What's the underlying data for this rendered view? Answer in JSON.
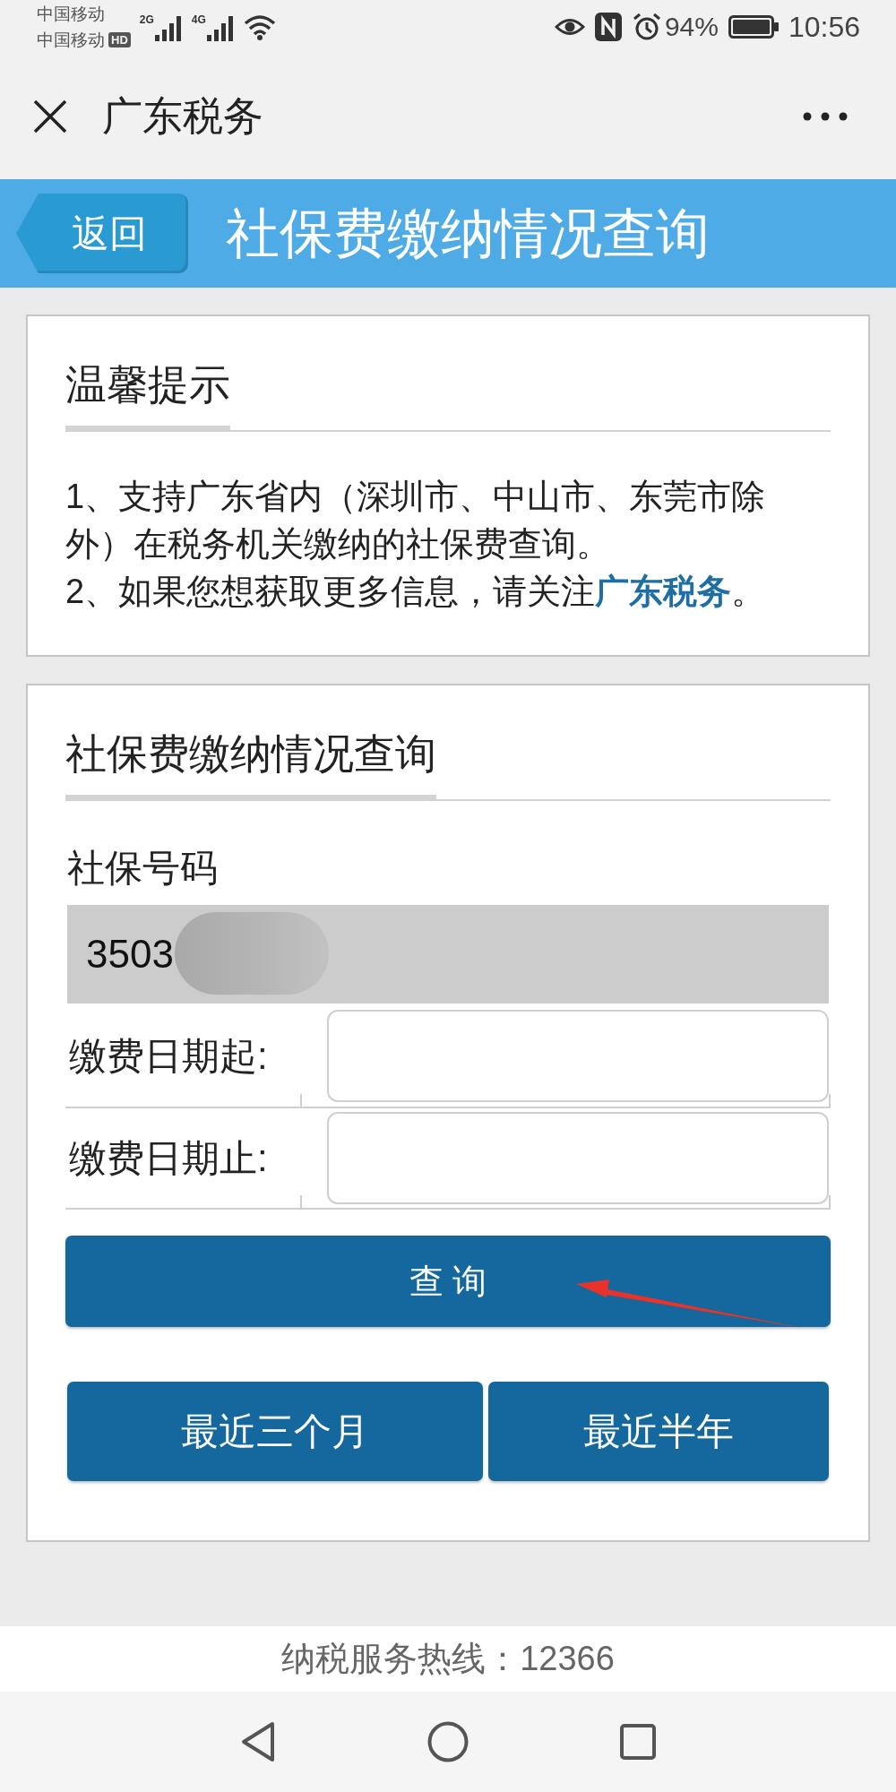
{
  "status_bar": {
    "carriers": [
      "中国移动",
      "中国移动"
    ],
    "hd_badge": "HD",
    "networks": [
      "2G",
      "4G"
    ],
    "battery": "94%",
    "time": "10:56"
  },
  "nav_bar": {
    "title": "广东税务"
  },
  "header": {
    "back_button": "返回",
    "title": "社保费缴纳情况查询"
  },
  "tips_card": {
    "title": "温馨提示",
    "items": [
      {
        "text": "1、支持广东省内（深圳市、中山市、东莞市除外）在税务机关缴纳的社保费查询。"
      },
      {
        "text": "2、如果您想获取更多信息，请关注",
        "link": "广东税务",
        "suffix": "。"
      }
    ]
  },
  "query_card": {
    "title": "社保费缴纳情况查询",
    "number_field": {
      "label": "社保号码",
      "value": "3503",
      "redacted": true
    },
    "date_fields": [
      {
        "label": "缴费日期起:"
      },
      {
        "label": "缴费日期止:"
      }
    ],
    "query_button": "查 询",
    "range_buttons": [
      "最近三个月",
      "最近半年"
    ]
  },
  "annotations": [
    {
      "kind": "arrow"
    }
  ],
  "footer": {
    "hotline": "纳税服务热线：12366"
  }
}
